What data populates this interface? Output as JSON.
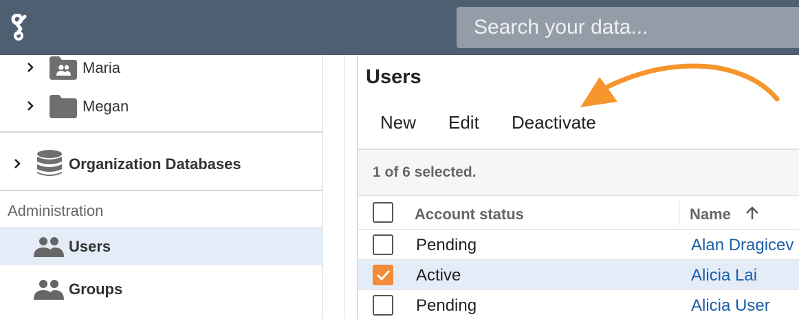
{
  "topbar": {
    "logo_icon": "app-logo-icon",
    "search_placeholder": "Search your data..."
  },
  "sidebar": {
    "tree_items": [
      {
        "label": "Maria",
        "icon": "shared-folder-icon"
      },
      {
        "label": "Megan",
        "icon": "folder-icon"
      }
    ],
    "org_databases": {
      "label": "Organization Databases",
      "icon": "database-icon"
    },
    "section_title": "Administration",
    "admin_items": [
      {
        "label": "Users",
        "icon": "users-icon",
        "active": true
      },
      {
        "label": "Groups",
        "icon": "groups-icon",
        "active": false
      }
    ]
  },
  "main": {
    "title": "Users",
    "toolbar": {
      "new_label": "New",
      "edit_label": "Edit",
      "deactivate_label": "Deactivate"
    },
    "selection_count": "1 of 6 selected.",
    "columns": {
      "status": "Account status",
      "name": "Name",
      "sort_icon": "arrow-up-icon"
    },
    "rows": [
      {
        "status": "Pending",
        "name": "Alan Dragicev",
        "checked": false
      },
      {
        "status": "Active",
        "name": "Alicia Lai",
        "checked": true
      },
      {
        "status": "Pending",
        "name": "Alicia User",
        "checked": false
      }
    ]
  },
  "colors": {
    "topbar": "#4f5f72",
    "search_bg": "#939ca7",
    "selection_bg": "#e4edf7",
    "checkbox_accent": "#f28c38",
    "link": "#1a5fa8",
    "annotation_arrow": "#f7952d"
  }
}
